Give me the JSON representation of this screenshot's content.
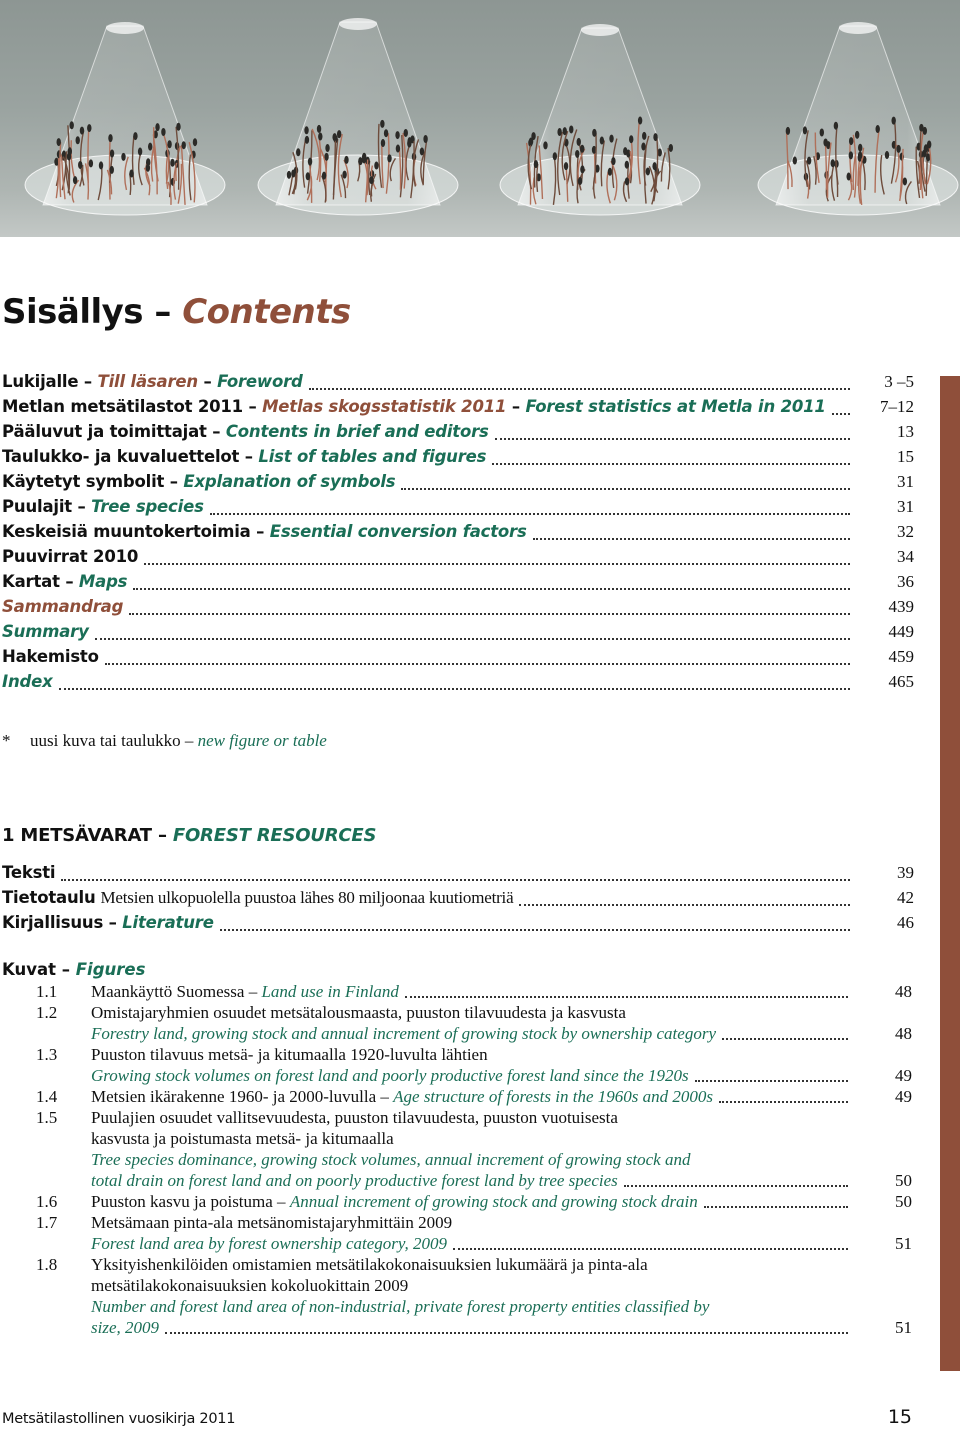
{
  "photo": {
    "description": "Four glass cone covers over petri dishes with germinating seedlings on a grey background",
    "colors": {
      "background": "#9aa3a0",
      "glass": "#e8eceb",
      "seedling_dark": "#2b2a27",
      "seedling_root": "#b0705a"
    }
  },
  "title": {
    "fi": "Sisällys",
    "dash": "–",
    "en": "Contents"
  },
  "colors": {
    "swedish": "#8f4f3a",
    "english": "#1a6e56",
    "side_bar": "#8f4f3a"
  },
  "toc": [
    {
      "fi": "Lukijalle",
      "sv": "Till läsaren",
      "en": "Foreword",
      "page": "3 –5"
    },
    {
      "fi": "Metlan metsätilastot 2011",
      "sv": "Metlas skogsstatistik 2011",
      "en": "Forest statistics at Metla in 2011",
      "page": "7–12"
    },
    {
      "fi": "Pääluvut ja toimittajat",
      "en": "Contents in brief and editors",
      "page": "13"
    },
    {
      "fi": "Taulukko- ja kuvaluettelot",
      "en": "List of tables and figures",
      "page": "15"
    },
    {
      "fi": "Käytetyt symbolit",
      "en": "Explanation of symbols",
      "page": "31"
    },
    {
      "fi": "Puulajit",
      "en": "Tree species",
      "page": "31"
    },
    {
      "fi": "Keskeisiä muuntokertoimia",
      "en": "Essential conversion factors",
      "page": "32"
    },
    {
      "fi": "Puuvirrat 2010",
      "page": "34"
    },
    {
      "fi": "Kartat",
      "en": "Maps",
      "page": "36"
    },
    {
      "sv": "Sammandrag",
      "page": "439"
    },
    {
      "en": "Summary",
      "page": "449"
    },
    {
      "fi": "Hakemisto",
      "page": "459"
    },
    {
      "en": "Index",
      "page": "465"
    }
  ],
  "footnote": {
    "symbol": "*",
    "fi": "uusi kuva tai taulukko –",
    "en": "new figure or table"
  },
  "section": {
    "number": "1",
    "fi": "METSÄVARAT",
    "dash": "–",
    "en": "FOREST RESOURCES",
    "entries": [
      {
        "fi": "Teksti",
        "page": "39"
      },
      {
        "fi": "Tietotaulu",
        "desc": "Metsien ulkopuolella puustoa lähes 80 miljoonaa kuutiometriä",
        "page": "42"
      },
      {
        "fi": "Kirjallisuus",
        "en": "Literature",
        "page": "46"
      }
    ],
    "figures_heading": {
      "fi": "Kuvat",
      "dash": "–",
      "en": "Figures"
    },
    "figures": [
      {
        "num": "1.1",
        "fi": "Maankäyttö Suomessa –",
        "en": "Land use in Finland",
        "page": "48"
      },
      {
        "num": "1.2",
        "fi": "Omistajaryhmien osuudet metsätalousmaasta, puuston tilavuudesta ja kasvusta",
        "en": "Forestry land, growing stock and annual increment of growing stock by ownership category",
        "page": "48"
      },
      {
        "num": "1.3",
        "fi": "Puuston tilavuus metsä- ja kitumaalla 1920-luvulta lähtien",
        "en": "Growing stock volumes on forest land and poorly productive forest land since the 1920s",
        "page": "49"
      },
      {
        "num": "1.4",
        "fi": "Metsien ikärakenne 1960- ja 2000-luvulla –",
        "en": "Age structure of forests in the 1960s and 2000s",
        "page": "49"
      },
      {
        "num": "1.5",
        "fi_lines": [
          "Puulajien osuudet vallitsevuudesta, puuston tilavuudesta, puuston vuotuisesta",
          "kasvusta ja poistumasta metsä- ja kitumaalla"
        ],
        "en_lines": [
          "Tree species dominance, growing stock volumes, annual increment of growing stock and",
          "total drain on forest land and on poorly productive forest land by tree species"
        ],
        "page": "50"
      },
      {
        "num": "1.6",
        "fi": "Puuston kasvu ja poistuma –",
        "en": "Annual increment of growing stock and growing stock drain",
        "page": "50"
      },
      {
        "num": "1.7",
        "fi": "Metsämaan pinta-ala metsänomistajaryhmittäin 2009",
        "en": "Forest land area by forest ownership category, 2009",
        "page": "51"
      },
      {
        "num": "1.8",
        "fi_lines": [
          "Yksityishenkilöiden omistamien metsätilakokonaisuuksien lukumäärä ja pinta-ala",
          "metsätilakokonaisuuksien kokoluokittain 2009"
        ],
        "en_lines": [
          "Number and forest land area of non-industrial, private forest property entities classified by",
          "size, 2009"
        ],
        "page": "51"
      }
    ]
  },
  "footer": {
    "publication": "Metsätilastollinen vuosikirja 2011",
    "page_number": "15"
  }
}
